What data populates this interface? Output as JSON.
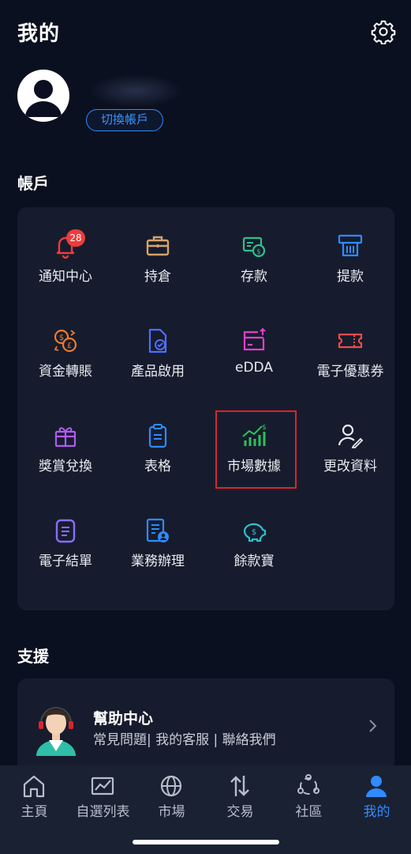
{
  "header": {
    "title": "我的",
    "settings_icon": "gear-icon"
  },
  "profile": {
    "avatar_icon": "user-avatar-icon",
    "switch_label": "切換帳戶"
  },
  "account": {
    "section_title": "帳戶",
    "items": [
      {
        "label": "通知中心",
        "icon": "bell-icon",
        "color": "#ef3b3b",
        "badge": "28"
      },
      {
        "label": "持倉",
        "icon": "briefcase-icon",
        "color": "#d7a36a"
      },
      {
        "label": "存款",
        "icon": "deposit-icon",
        "color": "#2fbf8c"
      },
      {
        "label": "提款",
        "icon": "atm-icon",
        "color": "#2f8bff"
      },
      {
        "label": "資金轉賬",
        "icon": "currency-exchange-icon",
        "color": "#f07a2a"
      },
      {
        "label": "產品啟用",
        "icon": "document-check-icon",
        "color": "#4f6dff"
      },
      {
        "label": "eDDA",
        "icon": "card-upload-icon",
        "color": "#e040c8"
      },
      {
        "label": "電子優惠券",
        "icon": "ticket-icon",
        "color": "#ef4b4b"
      },
      {
        "label": "獎賞兌換",
        "icon": "gift-icon",
        "color": "#b05cf0"
      },
      {
        "label": "表格",
        "icon": "clipboard-icon",
        "color": "#2f8bff"
      },
      {
        "label": "市場數據",
        "icon": "bar-chart-growth-icon",
        "color": "#2fbf5a"
      },
      {
        "label": "更改資料",
        "icon": "user-edit-icon",
        "color": "#e8eaf0"
      },
      {
        "label": "電子結單",
        "icon": "statement-icon",
        "color": "#8a6cff"
      },
      {
        "label": "業務辦理",
        "icon": "document-user-icon",
        "color": "#2f8bff"
      },
      {
        "label": "餘款寶",
        "icon": "piggy-bank-icon",
        "color": "#2fbfd0"
      }
    ]
  },
  "support": {
    "section_title": "支援",
    "help_title": "幫助中心",
    "help_subtitle": "常見問題| 我的客服 | 聯絡我們"
  },
  "tabbar": {
    "active_color": "#2f8bff",
    "tabs": [
      {
        "label": "主頁",
        "icon": "home-icon"
      },
      {
        "label": "自選列表",
        "icon": "watchlist-chart-icon"
      },
      {
        "label": "市場",
        "icon": "globe-icon"
      },
      {
        "label": "交易",
        "icon": "trade-arrows-icon"
      },
      {
        "label": "社區",
        "icon": "community-icon"
      },
      {
        "label": "我的",
        "icon": "profile-icon",
        "active": true
      }
    ]
  }
}
